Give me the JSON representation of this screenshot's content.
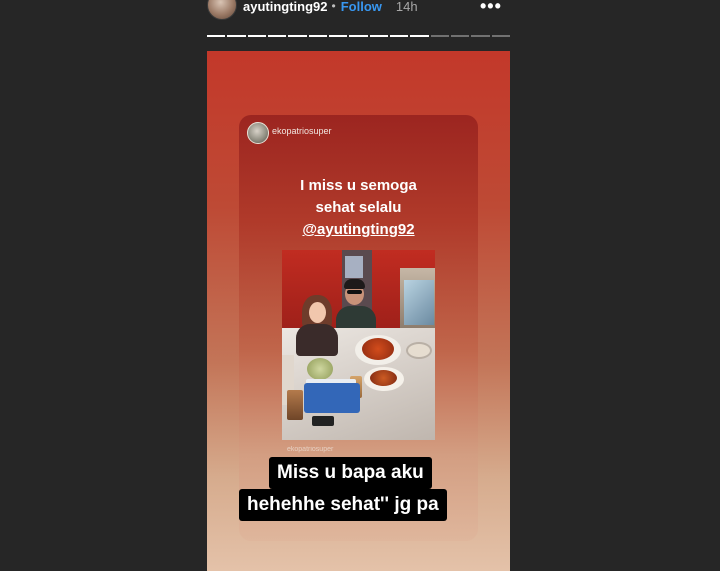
{
  "header": {
    "username": "ayutingting92",
    "separator": "•",
    "follow_label": "Follow",
    "time": "14h",
    "more_icon": "more-horizontal-icon",
    "more_label": "•••"
  },
  "progress": {
    "total_segments": 15,
    "completed_segments": 11
  },
  "story": {
    "reshared_from": "ekopatriosuper",
    "caption_line1": "I miss u semoga",
    "caption_line2": "sehat selalu",
    "mention": "@ayutingting92",
    "photo_watermark": "ekopatriosuper",
    "reply_line1": "Miss u bapa aku",
    "reply_line2": "hehehhe sehat'' jg pa"
  },
  "colors": {
    "background": "#262626",
    "follow": "#3897f0",
    "story_top": "#c3382a",
    "story_bottom": "#e4c2a9"
  }
}
